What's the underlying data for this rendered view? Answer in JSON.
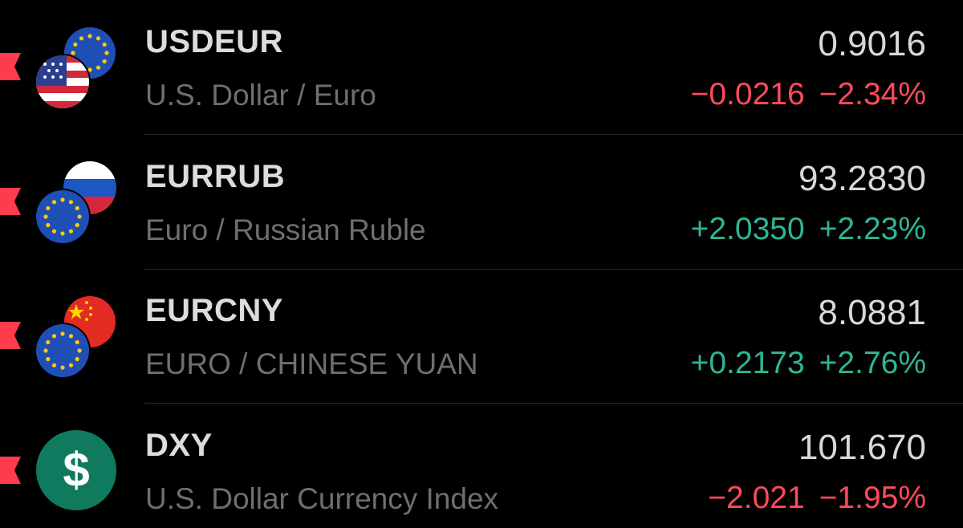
{
  "watchlist": {
    "rows": [
      {
        "symbol": "USDEUR",
        "name": "U.S. Dollar / Euro",
        "price": "0.9016",
        "change": "−0.0216",
        "change_percent": "−2.34%",
        "direction": "down",
        "icons": [
          "eu-flag-icon",
          "us-flag-icon"
        ]
      },
      {
        "symbol": "EURRUB",
        "name": "Euro / Russian Ruble",
        "price": "93.2830",
        "change": "+2.0350",
        "change_percent": "+2.23%",
        "direction": "up",
        "icons": [
          "russia-flag-icon",
          "eu-flag-icon"
        ]
      },
      {
        "symbol": "EURCNY",
        "name": "EURO / CHINESE YUAN",
        "price": "8.0881",
        "change": "+0.2173",
        "change_percent": "+2.76%",
        "direction": "up",
        "icons": [
          "china-flag-icon",
          "eu-flag-icon"
        ]
      },
      {
        "symbol": "DXY",
        "name": "U.S. Dollar Currency Index",
        "price": "101.670",
        "change": "−2.021",
        "change_percent": "−1.95%",
        "direction": "down",
        "icons": [
          "dollar-sign-icon"
        ]
      }
    ]
  },
  "colors": {
    "background": "#000000",
    "negative": "#ff4a5c",
    "positive": "#2fb596",
    "marker": "#ff3b4e",
    "symbol_text": "#dcdcdc",
    "name_text": "#6e6e73",
    "dollar_badge": "#0f7a5d"
  }
}
